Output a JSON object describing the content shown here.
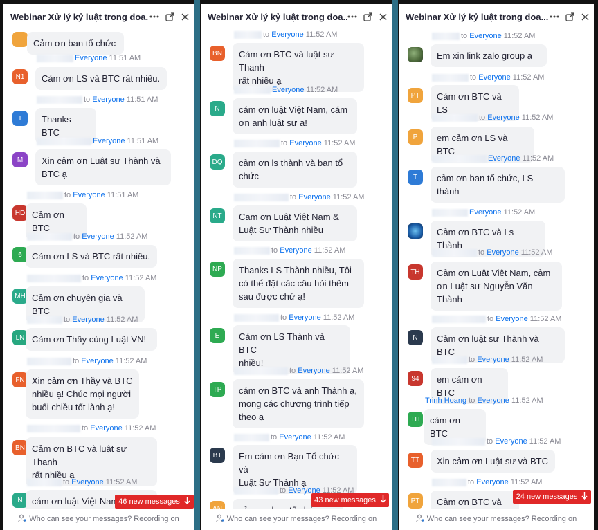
{
  "panels": [
    {
      "title": "Webinar Xử lý kỷ luật trong doa...",
      "new_messages": "46 new messages",
      "footer": "Who can see your messages? Recording on",
      "messages": [
        {
          "avatar": "",
          "color": "#f0a43c",
          "meta_to": "",
          "meta_rcpt": "",
          "time": "",
          "text": "Cảm ơn ban tổ chức"
        },
        {
          "avatar": "N1",
          "color": "#e8602c",
          "meta_to": "",
          "meta_rcpt": "Everyone",
          "time": "11:51 AM",
          "text": "Cảm ơn LS và BTC rất nhiều."
        },
        {
          "avatar": "I",
          "color": "#2e7bd6",
          "meta_to": "to",
          "meta_rcpt": "Everyone",
          "time": "11:51 AM",
          "text": "Thanks BTC"
        },
        {
          "avatar": "M",
          "color": "#8b44c6",
          "meta_to": "",
          "meta_rcpt": "Everyone",
          "time": "11:51 AM",
          "text": "Xin cảm ơn Luật sư Thành và\nBTC ạ"
        },
        {
          "avatar": "HD",
          "color": "#c8372e",
          "meta_to": "to",
          "meta_rcpt": "Everyone",
          "time": "11:51 AM",
          "text": "Cảm ơn BTC"
        },
        {
          "avatar": "6",
          "color": "#2eaa52",
          "meta_to": "to",
          "meta_rcpt": "Everyone",
          "time": "11:52 AM",
          "text": "Cảm ơn LS và BTC rất nhiều."
        },
        {
          "avatar": "MH",
          "color": "#2aaa8a",
          "meta_to": "to",
          "meta_rcpt": "Everyone",
          "time": "11:52 AM",
          "text": "Cảm ơn chuyên gia và BTC"
        },
        {
          "avatar": "LN",
          "color": "#27a77f",
          "meta_to": "to",
          "meta_rcpt": "Everyone",
          "time": "11:52 AM",
          "text": "Cảm ơn Thầy cùng Luật VN!"
        },
        {
          "avatar": "FN",
          "color": "#e8602c",
          "meta_to": "to",
          "meta_rcpt": "Everyone",
          "time": "11:52 AM",
          "text": "Xin cảm ơn Thầy và BTC\nnhiều ạ! Chúc mọi người\nbuổi chiều tốt lành ạ!"
        },
        {
          "avatar": "BN",
          "color": "#e8602c",
          "meta_to": "to",
          "meta_rcpt": "Everyone",
          "time": "11:52 AM",
          "text": "Cảm ơn BTC và luật sư Thanh\nrất nhiều ạ"
        },
        {
          "avatar": "N",
          "color": "#2aaa8a",
          "meta_to": "to",
          "meta_rcpt": "Everyone",
          "time": "11:52 AM",
          "text": "cám ơn luật Việt Nam, cám\nơn anh luật sư ạ!"
        }
      ]
    },
    {
      "title": "Webinar Xử lý kỷ luật trong doa...",
      "new_messages": "43 new messages",
      "footer": "Who can see your messages? Recording on",
      "messages": [
        {
          "avatar": "BN",
          "color": "#e8602c",
          "meta_to": "to",
          "meta_rcpt": "Everyone",
          "time": "11:52 AM",
          "text": "Cảm ơn BTC và luật sư Thanh\nrất nhiều ạ"
        },
        {
          "avatar": "N",
          "color": "#2aaa8a",
          "meta_to": "",
          "meta_rcpt": "Everyone",
          "time": "11:52 AM",
          "text": "cám ơn luật Việt Nam, cám\nơn anh luật sư ạ!"
        },
        {
          "avatar": "DQ",
          "color": "#2aaa8a",
          "meta_to": "to",
          "meta_rcpt": "Everyone",
          "time": "11:52 AM",
          "text": "cảm ơn ls thành và ban tổ\nchức"
        },
        {
          "avatar": "NT",
          "color": "#2aaa8a",
          "meta_to": "to",
          "meta_rcpt": "Everyone",
          "time": "11:52 AM",
          "text": "Cam ơn Luật Việt Nam &\nLuật Sư Thành nhiều"
        },
        {
          "avatar": "NP",
          "color": "#2eaa52",
          "meta_to": "to",
          "meta_rcpt": "Everyone",
          "time": "11:52 AM",
          "text": "Thanks LS Thành nhiều, Tôi\ncó thể đặt các câu hỏi thêm\nsau được chứ ạ!"
        },
        {
          "avatar": "E",
          "color": "#2eaa52",
          "meta_to": "to",
          "meta_rcpt": "Everyone",
          "time": "11:52 AM",
          "text": "Cảm ơn LS Thành và BTC\nnhiều!"
        },
        {
          "avatar": "TP",
          "color": "#2eaa52",
          "meta_to": "to",
          "meta_rcpt": "Everyone",
          "time": "11:52 AM",
          "text": "cảm ơn BTC và anh Thành ạ,\nmong các chương trình tiếp\ntheo ạ"
        },
        {
          "avatar": "BT",
          "color": "#2b3a4e",
          "meta_to": "to",
          "meta_rcpt": "Everyone",
          "time": "11:52 AM",
          "text": "Em cảm ơn Bạn Tổ chức và\nLuật Sư Thành ạ"
        },
        {
          "avatar": "AN",
          "color": "#f0a43c",
          "meta_to": "to",
          "meta_rcpt": "Everyone",
          "time": "11:52 AM",
          "text": "cảm ơn ban tổ chức"
        }
      ]
    },
    {
      "title": "Webinar Xử lý kỷ luật trong doa...",
      "new_messages": "24 new messages",
      "footer": "Who can see your messages? Recording on",
      "messages": [
        {
          "avatar": "",
          "color": "photo",
          "meta_to": "to",
          "meta_rcpt": "Everyone",
          "time": "11:52 AM",
          "text": "Em xin link zalo group ạ"
        },
        {
          "avatar": "PT",
          "color": "#f0a43c",
          "meta_to": "to",
          "meta_rcpt": "Everyone",
          "time": "11:52 AM",
          "text": "Cảm ơn BTC và LS"
        },
        {
          "avatar": "P",
          "color": "#f0a43c",
          "meta_to": "to",
          "meta_rcpt": "Everyone",
          "time": "11:52 AM",
          "text": "em cảm ơn LS và BTC"
        },
        {
          "avatar": "T",
          "color": "#2e7bd6",
          "meta_to": "",
          "meta_rcpt": "Everyone",
          "time": "11:52 AM",
          "text": "cảm ơn ban tổ chức, LS\nthành"
        },
        {
          "avatar": "",
          "color": "photo2",
          "meta_to": "",
          "meta_rcpt": "Everyone",
          "time": "11:52 AM",
          "text": "Cảm ơn BTC và Ls Thành"
        },
        {
          "avatar": "TH",
          "color": "#c8372e",
          "meta_to": "to",
          "meta_rcpt": "Everyone",
          "time": "11:52 AM",
          "text": "Cảm ơn Luật Việt Nam, cảm\nơn Luật sư Nguyễn Văn\nThành"
        },
        {
          "avatar": "N",
          "color": "#2b3a4e",
          "meta_to": "to",
          "meta_rcpt": "Everyone",
          "time": "11:52 AM",
          "text": "Cảm ơn luật sư Thành và BTC"
        },
        {
          "avatar": "94",
          "color": "#c8372e",
          "meta_to": "to",
          "meta_rcpt": "Everyone",
          "time": "11:52 AM",
          "text": "em cảm ơn BTC"
        },
        {
          "avatar": "TH",
          "color": "#2eaa52",
          "meta_sender": "Trinh Hoang",
          "meta_to": "to",
          "meta_rcpt": "Everyone",
          "time": "11:52 AM",
          "text": "cảm ơn BTC"
        },
        {
          "avatar": "TT",
          "color": "#e8602c",
          "meta_to": "to",
          "meta_rcpt": "Everyone",
          "time": "11:52 AM",
          "text": "Xin cảm ơn Luật sư và BTC"
        },
        {
          "avatar": "PT",
          "color": "#f0a43c",
          "meta_to": "to",
          "meta_rcpt": "Everyone",
          "time": "11:52 AM",
          "text": "Cảm ơn BTC và LS"
        }
      ]
    }
  ]
}
